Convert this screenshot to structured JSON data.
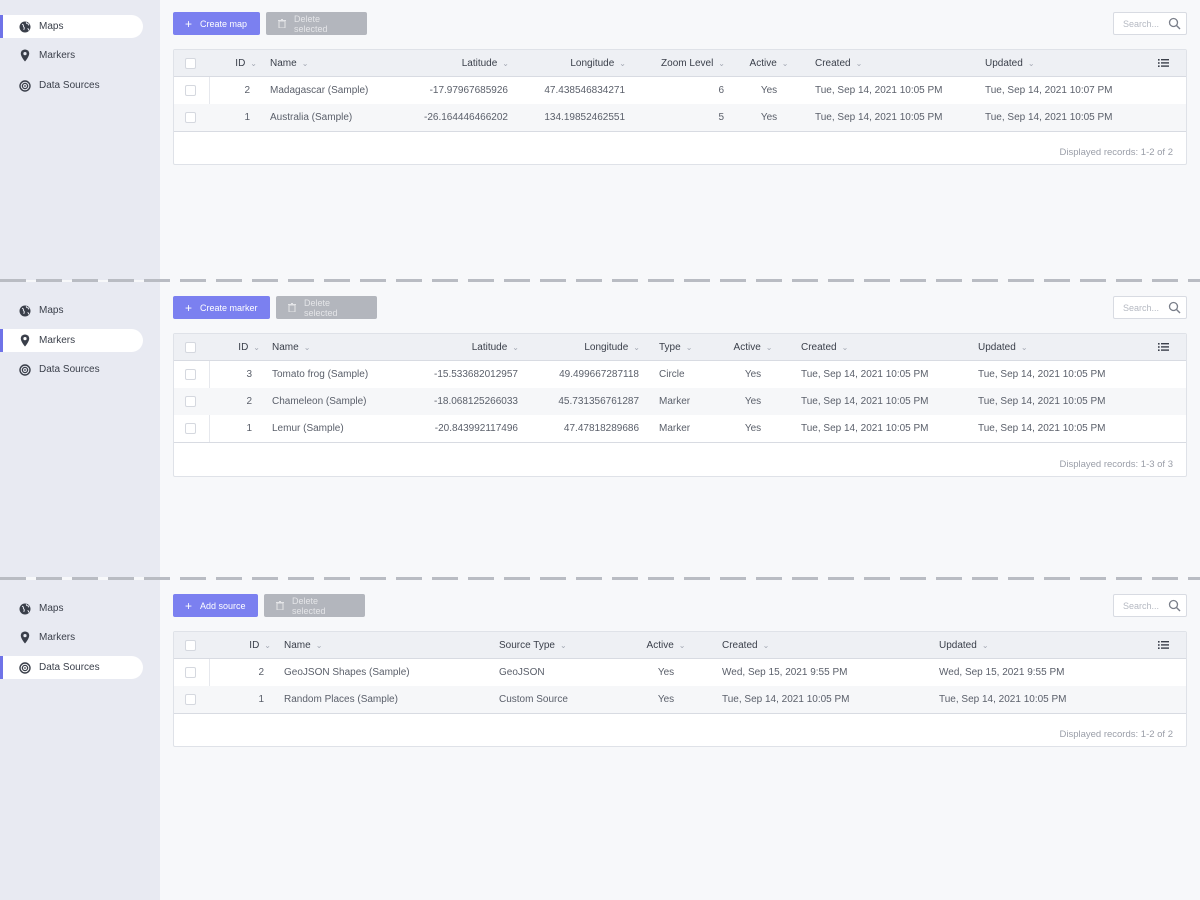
{
  "colors": {
    "accent": "#6f73e8",
    "primary_button": "#7b80f0",
    "disabled_button": "#b3b6bd",
    "sidebar_bg": "#e8eaf2"
  },
  "sidebar": {
    "items": [
      {
        "label": "Maps",
        "icon": "globe-icon"
      },
      {
        "label": "Markers",
        "icon": "map-pin-icon"
      },
      {
        "label": "Data Sources",
        "icon": "target-icon"
      }
    ]
  },
  "maps": {
    "create_label": "Create map",
    "delete_label": "Delete selected",
    "search_placeholder": "Search...",
    "columns": [
      "ID",
      "Name",
      "Latitude",
      "Longitude",
      "Zoom Level",
      "Active",
      "Created",
      "Updated"
    ],
    "rows": [
      {
        "id": "2",
        "name": "Madagascar (Sample)",
        "lat": "-17.97967685926",
        "lng": "47.438546834271",
        "zoom": "6",
        "active": "Yes",
        "created": "Tue, Sep 14, 2021 10:05 PM",
        "updated": "Tue, Sep 14, 2021 10:07 PM"
      },
      {
        "id": "1",
        "name": "Australia (Sample)",
        "lat": "-26.164446466202",
        "lng": "134.19852462551",
        "zoom": "5",
        "active": "Yes",
        "created": "Tue, Sep 14, 2021 10:05 PM",
        "updated": "Tue, Sep 14, 2021 10:05 PM"
      }
    ],
    "footer": "Displayed records: 1-2 of 2"
  },
  "markers": {
    "create_label": "Create marker",
    "delete_label": "Delete selected",
    "search_placeholder": "Search...",
    "columns": [
      "ID",
      "Name",
      "Latitude",
      "Longitude",
      "Type",
      "Active",
      "Created",
      "Updated"
    ],
    "rows": [
      {
        "id": "3",
        "name": "Tomato frog (Sample)",
        "lat": "-15.533682012957",
        "lng": "49.499667287118",
        "type": "Circle",
        "active": "Yes",
        "created": "Tue, Sep 14, 2021 10:05 PM",
        "updated": "Tue, Sep 14, 2021 10:05 PM"
      },
      {
        "id": "2",
        "name": "Chameleon (Sample)",
        "lat": "-18.068125266033",
        "lng": "45.731356761287",
        "type": "Marker",
        "active": "Yes",
        "created": "Tue, Sep 14, 2021 10:05 PM",
        "updated": "Tue, Sep 14, 2021 10:05 PM"
      },
      {
        "id": "1",
        "name": "Lemur (Sample)",
        "lat": "-20.843992117496",
        "lng": "47.47818289686",
        "type": "Marker",
        "active": "Yes",
        "created": "Tue, Sep 14, 2021 10:05 PM",
        "updated": "Tue, Sep 14, 2021 10:05 PM"
      }
    ],
    "footer": "Displayed records: 1-3 of 3"
  },
  "sources": {
    "create_label": "Add source",
    "delete_label": "Delete selected",
    "search_placeholder": "Search...",
    "columns": [
      "ID",
      "Name",
      "Source Type",
      "Active",
      "Created",
      "Updated"
    ],
    "rows": [
      {
        "id": "2",
        "name": "GeoJSON Shapes (Sample)",
        "stype": "GeoJSON",
        "active": "Yes",
        "created": "Wed, Sep 15, 2021 9:55 PM",
        "updated": "Wed, Sep 15, 2021 9:55 PM"
      },
      {
        "id": "1",
        "name": "Random Places (Sample)",
        "stype": "Custom Source",
        "active": "Yes",
        "created": "Tue, Sep 14, 2021 10:05 PM",
        "updated": "Tue, Sep 14, 2021 10:05 PM"
      }
    ],
    "footer": "Displayed records: 1-2 of 2"
  }
}
